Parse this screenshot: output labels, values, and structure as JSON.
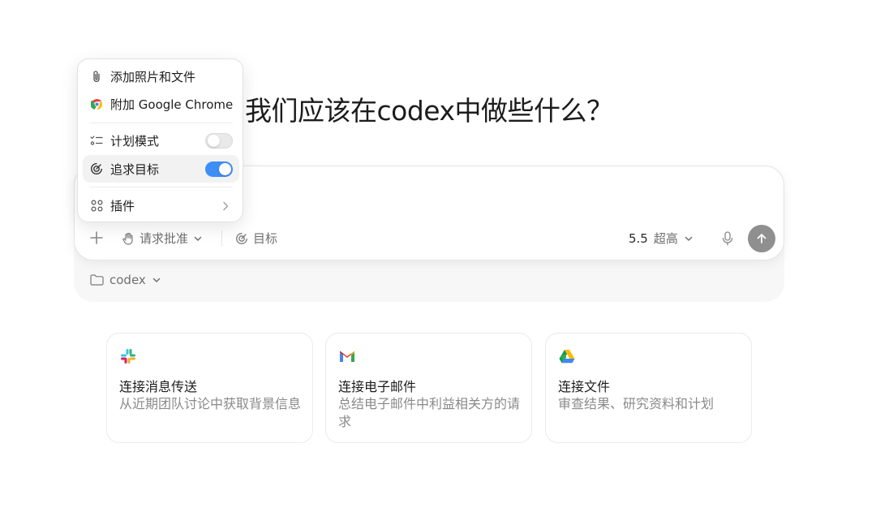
{
  "headline": "我们应该在codex中做些什么？",
  "menu": {
    "items": [
      {
        "label": "添加照片和文件",
        "icon": "paperclip-icon"
      },
      {
        "label": "附加 Google Chrome",
        "icon": "chrome-icon"
      },
      {
        "label": "计划模式",
        "icon": "checklist-icon",
        "toggle": false
      },
      {
        "label": "追求目标",
        "icon": "goal-icon",
        "toggle": true
      },
      {
        "label": "插件",
        "icon": "plugins-icon"
      }
    ]
  },
  "composer": {
    "approval_label": "请求批准",
    "goal_label": "目标",
    "model_version": "5.5",
    "reasoning_level": "超高"
  },
  "folder": {
    "label": "codex"
  },
  "cards": [
    {
      "title": "连接消息传送",
      "desc": "从近期团队讨论中获取背景信息",
      "logo": "slack-icon"
    },
    {
      "title": "连接电子邮件",
      "desc": "总结电子邮件中利益相关方的请求",
      "logo": "gmail-icon"
    },
    {
      "title": "连接文件",
      "desc": "审查结果、研究资料和计划",
      "logo": "google-drive-icon"
    }
  ],
  "colors": {
    "toggle_on": "#3d8ef5",
    "send_button": "#8f8f8f"
  }
}
